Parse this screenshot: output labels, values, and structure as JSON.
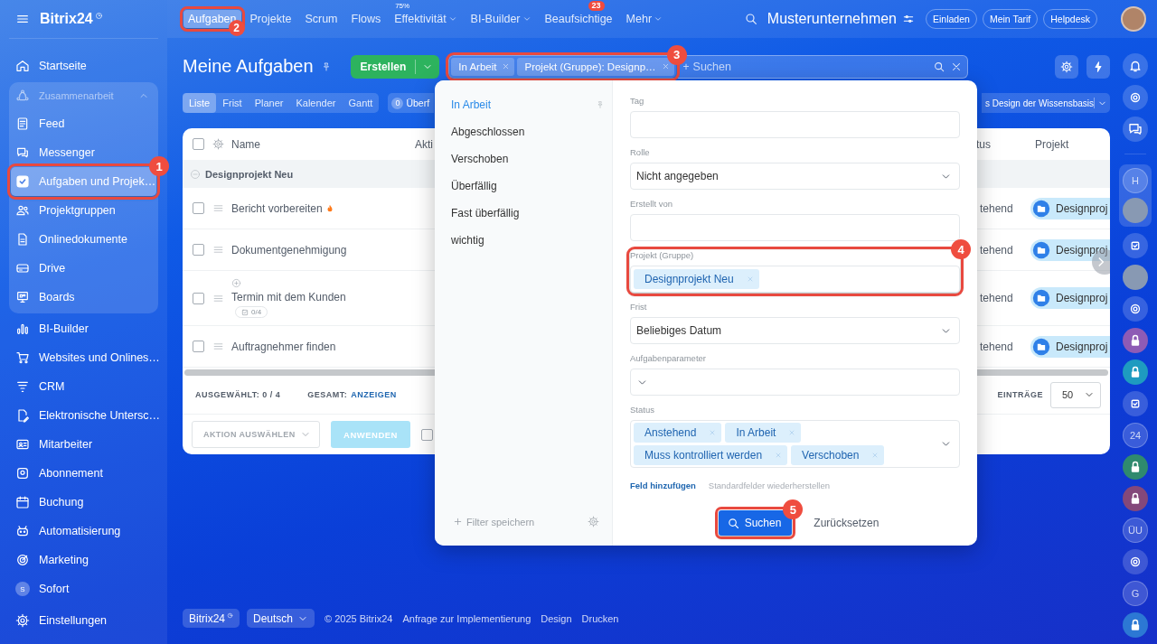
{
  "sidebar": {
    "logo": "Bitrix24",
    "items": [
      {
        "kind": "home",
        "label": "Startseite",
        "selected": false
      },
      {
        "kind": "network",
        "label": "Zusammenarbeit",
        "expanded": true,
        "children": [
          {
            "kind": "feed",
            "label": "Feed",
            "selected": false
          },
          {
            "kind": "chat",
            "label": "Messenger",
            "selected": false
          },
          {
            "kind": "tasks",
            "label": "Aufgaben und Projek…",
            "selected": true,
            "callout": "1"
          },
          {
            "kind": "group",
            "label": "Projektgruppen",
            "selected": false
          },
          {
            "kind": "doc",
            "label": "Onlinedokumente",
            "selected": false
          },
          {
            "kind": "drive",
            "label": "Drive",
            "selected": false
          },
          {
            "kind": "board",
            "label": "Boards",
            "selected": false
          }
        ]
      },
      {
        "kind": "chart",
        "label": "BI-Builder",
        "selected": false
      },
      {
        "kind": "cart",
        "label": "Websites und Onlines…",
        "selected": false
      },
      {
        "kind": "funnel",
        "label": "CRM",
        "selected": false
      },
      {
        "kind": "sign",
        "label": "Elektronische Untersc…",
        "selected": false
      },
      {
        "kind": "staff",
        "label": "Mitarbeiter",
        "selected": false
      },
      {
        "kind": "seal",
        "label": "Abonnement",
        "selected": false
      },
      {
        "kind": "calendar",
        "label": "Buchung",
        "selected": false
      },
      {
        "kind": "robot",
        "label": "Automatisierung",
        "selected": false
      },
      {
        "kind": "target",
        "label": "Marketing",
        "selected": false
      },
      {
        "kind": "letter",
        "letter": "S",
        "label": "Sofort",
        "selected": false
      }
    ],
    "settings": {
      "label": "Einstellungen",
      "selected": false
    }
  },
  "topnav": {
    "tabs": [
      {
        "label": "Aufgaben",
        "selected": true,
        "dropdown": false,
        "callout": "2"
      },
      {
        "label": "Projekte",
        "selected": false,
        "dropdown": false
      },
      {
        "label": "Scrum",
        "selected": false,
        "dropdown": false
      },
      {
        "label": "Flows",
        "selected": false,
        "dropdown": false
      },
      {
        "label": "Effektivität",
        "selected": false,
        "dropdown": true,
        "note": "75%"
      },
      {
        "label": "BI-Builder",
        "selected": false,
        "dropdown": true
      },
      {
        "label": "Beaufsichtige",
        "selected": false,
        "dropdown": false,
        "counter": "23"
      },
      {
        "label": "Mehr",
        "selected": false,
        "dropdown": true
      }
    ],
    "company": "Musterunternehmen",
    "buttons": [
      "Einladen",
      "Mein Tarif",
      "Helpdesk"
    ]
  },
  "header": {
    "title": "Meine Aufgaben",
    "create_button": "Erstellen",
    "search": {
      "chips": [
        "In Arbeit",
        "Projekt (Gruppe): Designp…"
      ],
      "callout": "3",
      "add": "+",
      "placeholder": "Suchen"
    }
  },
  "views": [
    {
      "label": "Liste",
      "selected": true
    },
    {
      "label": "Frist",
      "selected": false
    },
    {
      "label": "Planer",
      "selected": false
    },
    {
      "label": "Kalender",
      "selected": false
    },
    {
      "label": "Gantt",
      "selected": false
    }
  ],
  "counter_chip": {
    "count": "0",
    "label": "Überf"
  },
  "preset_dropdown": "s Design der Wissensbasis",
  "table": {
    "select_all": {
      "checked": false
    },
    "columns": [
      "Name",
      "Akti",
      "tus",
      "Projekt"
    ],
    "group": {
      "label": "Designprojekt Neu",
      "expanded": true
    },
    "rows": [
      {
        "name": "Bericht vorbereiten",
        "checked": false,
        "hot": true,
        "subtasks": false,
        "column_3": "tehend",
        "project": "Designproj"
      },
      {
        "name": "Dokumentgenehmigung",
        "checked": false,
        "hot": false,
        "subtasks": false,
        "column_3": "tehend",
        "project": "Designproj"
      },
      {
        "name": "Termin mit dem Kunden",
        "checked": false,
        "hot": false,
        "subtasks": true,
        "checklist": "0/4",
        "column_3": "tehend",
        "project": "Designproj"
      },
      {
        "name": "Auftragnehmer finden",
        "checked": false,
        "hot": false,
        "subtasks": false,
        "column_3": "tehend",
        "project": "Designproj"
      }
    ],
    "stats": {
      "selected": "AUSGEWÄHLT: **0 / 4**",
      "total_label": "GESAMT:",
      "total_link": "ANZEIGEN",
      "page_size_label": "EINTRÄGE",
      "page_size": "50"
    },
    "actions": {
      "select": "AKTION AUSWÄHLEN",
      "apply": {
        "label": "ANWENDEN",
        "disabled": true
      },
      "checkbox": {
        "checked": false
      }
    }
  },
  "footer": {
    "logo": "Bitrix24",
    "language": "Deutsch",
    "copyright": "© 2025 Bitrix24",
    "links": [
      "Anfrage zur Implementierung",
      "Design",
      "Drucken"
    ]
  },
  "rail": {
    "top": [
      {
        "kind": "bell"
      },
      {
        "kind": "ring"
      },
      {
        "kind": "chat"
      }
    ],
    "pinned": [
      {
        "kind": "letter",
        "text": "H"
      },
      {
        "kind": "avatar"
      }
    ],
    "items": [
      {
        "kind": "task"
      },
      {
        "kind": "avatar"
      },
      {
        "kind": "ring"
      },
      {
        "kind": "lock",
        "color": "#8e5bb5"
      },
      {
        "kind": "lock",
        "color": "#1e9bc0"
      },
      {
        "kind": "task"
      },
      {
        "kind": "letter",
        "text": "24"
      },
      {
        "kind": "lock",
        "color": "#2f8a6e"
      },
      {
        "kind": "lock",
        "color": "#84487a"
      },
      {
        "kind": "letter",
        "text": "ÜU"
      },
      {
        "kind": "ring"
      },
      {
        "kind": "letter",
        "text": "G"
      },
      {
        "kind": "lock",
        "color": "#2c78d4"
      }
    ]
  },
  "filter": {
    "presets": [
      {
        "label": "In Arbeit",
        "selected": true,
        "pinned": true
      },
      {
        "label": "Abgeschlossen",
        "selected": false,
        "pinned": false
      },
      {
        "label": "Verschoben",
        "selected": false,
        "pinned": false
      },
      {
        "label": "Überfällig",
        "selected": false,
        "pinned": false
      },
      {
        "label": "Fast überfällig",
        "selected": false,
        "pinned": false
      },
      {
        "label": "wichtig",
        "selected": false,
        "pinned": false
      }
    ],
    "save_filter": "Filter speichern",
    "fields": [
      {
        "kind": "text",
        "label": "Tag"
      },
      {
        "kind": "select",
        "label": "Rolle",
        "value": "Nicht angegeben"
      },
      {
        "kind": "text",
        "label": "Erstellt von"
      },
      {
        "kind": "chips",
        "label": "Projekt (Gruppe)",
        "chips": [
          "Designprojekt Neu"
        ],
        "dropdown": false,
        "callout": "4"
      },
      {
        "kind": "select",
        "label": "Frist",
        "value": "Beliebiges Datum"
      },
      {
        "kind": "select",
        "label": "Aufgabenparameter"
      },
      {
        "kind": "chips",
        "label": "Status",
        "chips": [
          "Anstehend",
          "In Arbeit",
          "Muss kontrolliert werden",
          "Verschoben"
        ],
        "dropdown": true
      }
    ],
    "add_field": "Feld hinzufügen",
    "restore": "Standardfelder wiederherstellen",
    "search_button": {
      "label": "Suchen",
      "callout": "5"
    },
    "reset_button": "Zurücksetzen"
  }
}
